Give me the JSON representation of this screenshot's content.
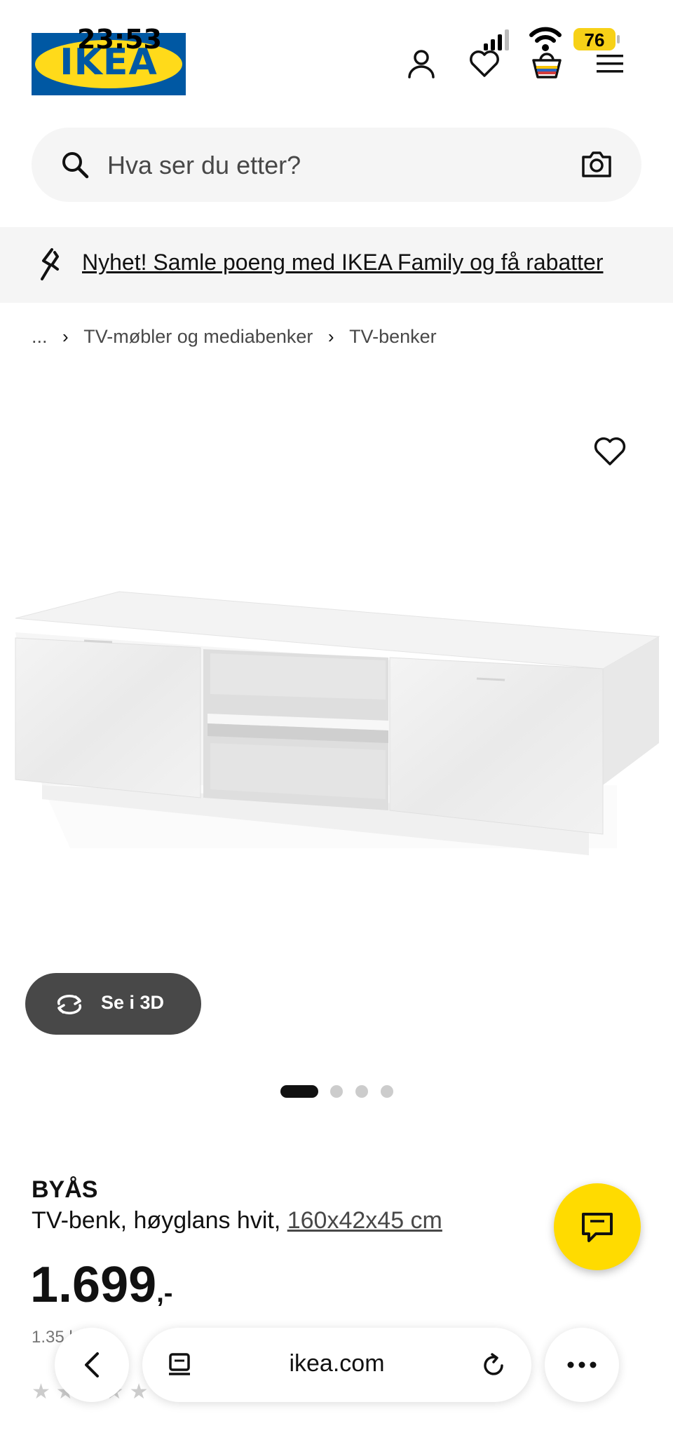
{
  "status_bar": {
    "time": "23:53",
    "battery": "76"
  },
  "header": {
    "logo_text": "IKEA"
  },
  "search": {
    "placeholder": "Hva ser du etter?"
  },
  "promo": {
    "text": "Nyhet! Samle poeng med IKEA Family og få rabatter"
  },
  "breadcrumb": {
    "ellipsis": "...",
    "items": [
      "TV-møbler og mediabenker",
      "TV-benker"
    ]
  },
  "gallery": {
    "view_3d_label": "Se i 3D",
    "slide_count": 4,
    "active_slide": 1
  },
  "product": {
    "name": "BYÅS",
    "description": "TV-benk, høyglans hvit, ",
    "dimensions": "160x42x45 cm",
    "price": "1.699",
    "price_suffix": ",-",
    "sub_price_partial": "1.35   ksk!",
    "rating_stars": "★★★★★"
  },
  "browser": {
    "url": "ikea.com"
  },
  "colors": {
    "ikea_blue": "#0058a3",
    "ikea_yellow": "#ffda1a",
    "chat_yellow": "#ffdb00",
    "button_dark": "#484848"
  }
}
